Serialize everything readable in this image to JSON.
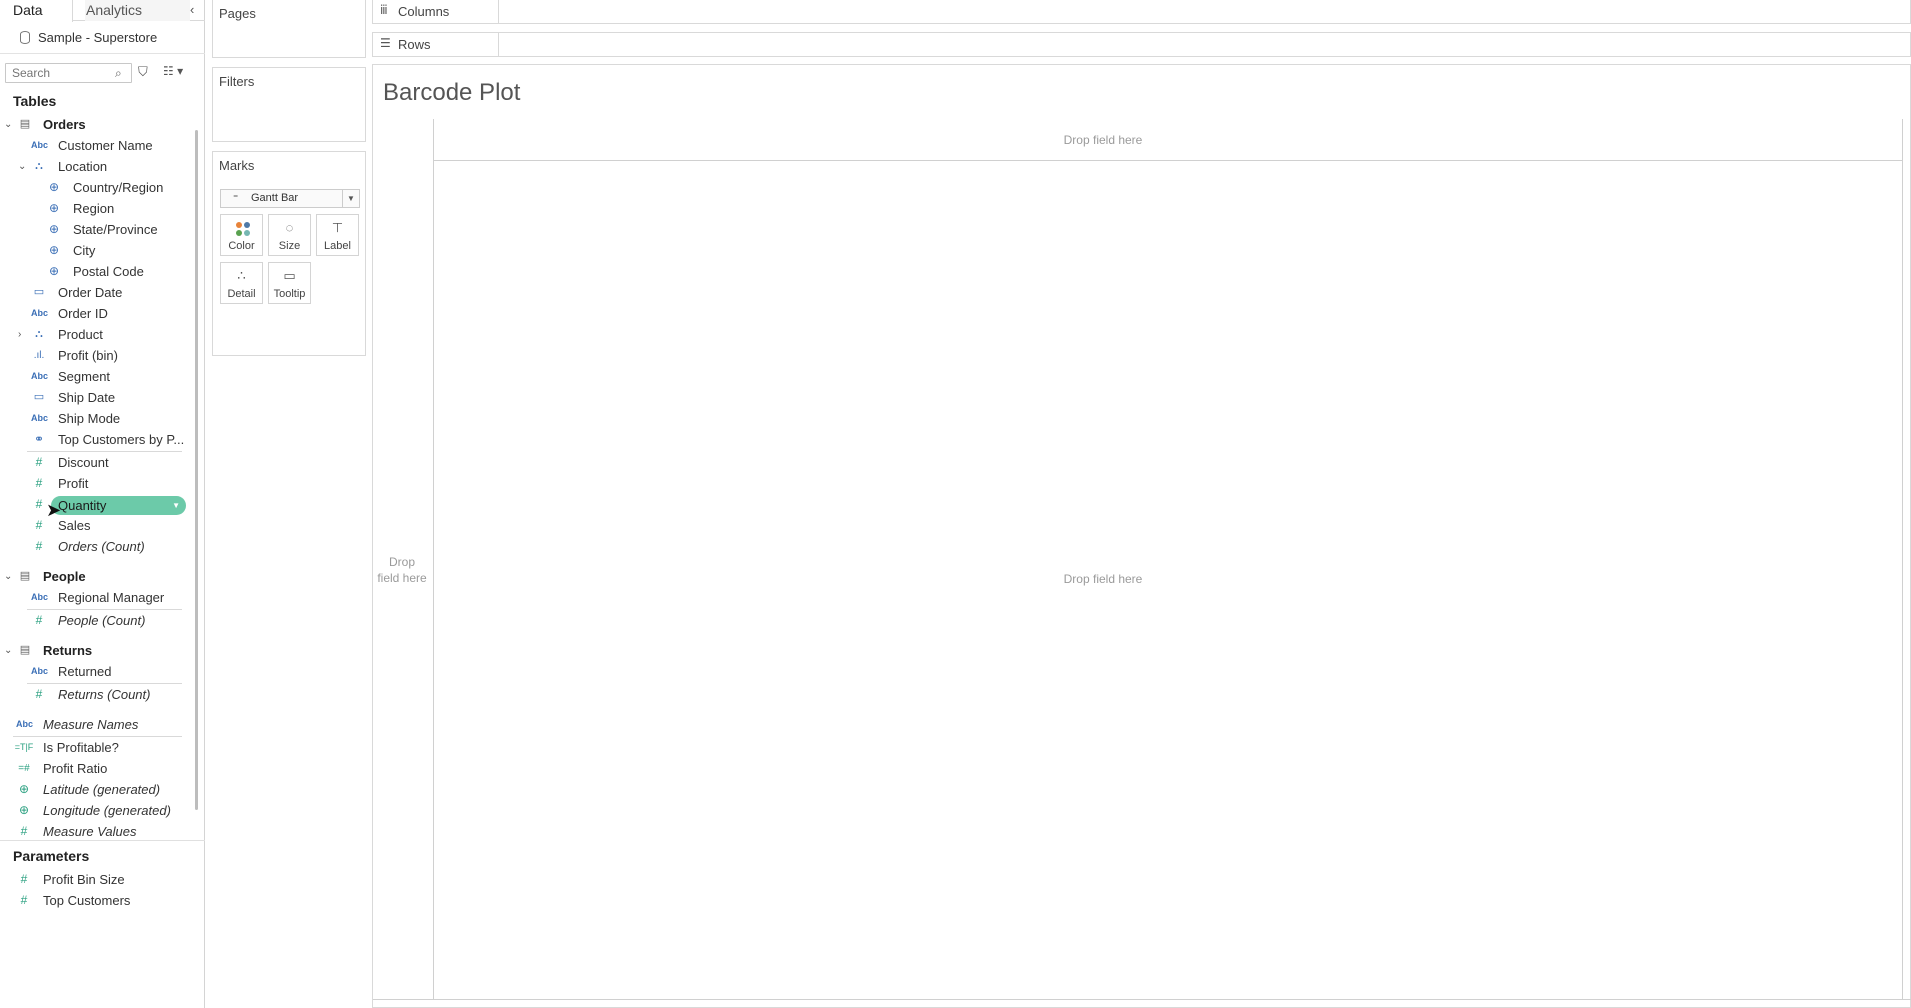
{
  "tabs": {
    "data": "Data",
    "analytics": "Analytics",
    "collapse": "‹"
  },
  "datasource": "Sample - Superstore",
  "search": {
    "placeholder": "Search"
  },
  "sections": {
    "tables": "Tables",
    "parameters": "Parameters"
  },
  "tables": [
    {
      "name": "Orders",
      "fields": [
        {
          "label": "Customer Name",
          "type": "abc"
        },
        {
          "label": "Location",
          "type": "hierarchy"
        },
        {
          "label": "Country/Region",
          "type": "geo"
        },
        {
          "label": "Region",
          "type": "geo"
        },
        {
          "label": "State/Province",
          "type": "geo"
        },
        {
          "label": "City",
          "type": "geo"
        },
        {
          "label": "Postal Code",
          "type": "geo"
        },
        {
          "label": "Order Date",
          "type": "date"
        },
        {
          "label": "Order ID",
          "type": "abc"
        },
        {
          "label": "Product",
          "type": "hierarchy"
        },
        {
          "label": "Profit (bin)",
          "type": "bin"
        },
        {
          "label": "Segment",
          "type": "abc"
        },
        {
          "label": "Ship Date",
          "type": "date"
        },
        {
          "label": "Ship Mode",
          "type": "abc"
        },
        {
          "label": "Top Customers by P...",
          "type": "set"
        },
        {
          "label": "Discount",
          "type": "number"
        },
        {
          "label": "Profit",
          "type": "number"
        },
        {
          "label": "Quantity",
          "type": "number"
        },
        {
          "label": "Sales",
          "type": "number"
        },
        {
          "label": "Orders (Count)",
          "type": "number"
        }
      ]
    },
    {
      "name": "People",
      "fields": [
        {
          "label": "Regional Manager",
          "type": "abc"
        },
        {
          "label": "People (Count)",
          "type": "number"
        }
      ]
    },
    {
      "name": "Returns",
      "fields": [
        {
          "label": "Returned",
          "type": "abc"
        },
        {
          "label": "Returns (Count)",
          "type": "number"
        }
      ]
    }
  ],
  "calculated": [
    {
      "label": "Measure Names",
      "type": "abc"
    },
    {
      "label": "Is Profitable?",
      "type": "boolean"
    },
    {
      "label": "Profit Ratio",
      "type": "calc-number"
    },
    {
      "label": "Latitude (generated)",
      "type": "geo"
    },
    {
      "label": "Longitude (generated)",
      "type": "geo"
    },
    {
      "label": "Measure Values",
      "type": "number"
    }
  ],
  "parameters": [
    {
      "label": "Profit Bin Size",
      "type": "number"
    },
    {
      "label": "Top Customers",
      "type": "number"
    }
  ],
  "cards": {
    "pages": "Pages",
    "filters": "Filters",
    "marks": "Marks"
  },
  "marks": {
    "type": "Gantt Bar",
    "buttons": {
      "color": "Color",
      "size": "Size",
      "label": "Label",
      "detail": "Detail",
      "tooltip": "Tooltip"
    }
  },
  "shelves": {
    "columns": "Columns",
    "rows": "Rows"
  },
  "view": {
    "title": "Barcode Plot",
    "drop_columns": "Drop field here",
    "drop_center": "Drop field here",
    "drop_rows": "Drop field here"
  },
  "colors": {
    "pill": "#6ccaa9",
    "dimension_icon": "#3b6fb6",
    "measure_icon": "#2aa080"
  }
}
